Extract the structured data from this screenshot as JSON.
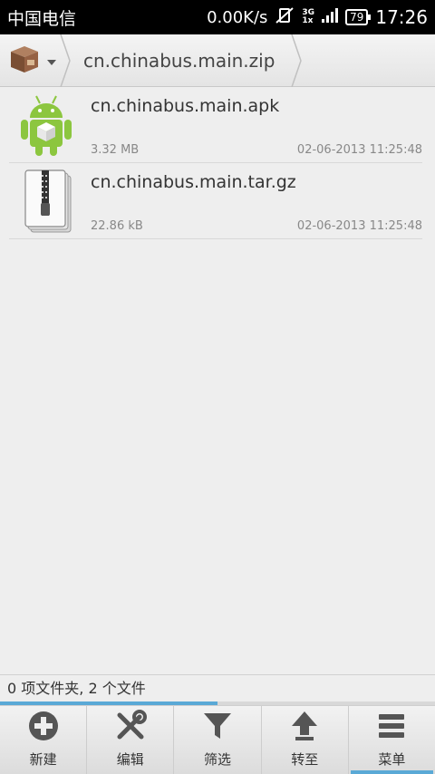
{
  "status": {
    "carrier": "中国电信",
    "netspeed": "0.00K/s",
    "sig_top": "3G",
    "sig_bottom": "1x",
    "battery": "79",
    "time": "17:26"
  },
  "breadcrumb": {
    "home_icon": "archive-box-icon",
    "path": "cn.chinabus.main.zip"
  },
  "files": [
    {
      "name": "cn.chinabus.main.apk",
      "size": "3.32 MB",
      "date": "02-06-2013 11:25:48",
      "icon": "android-apk-icon"
    },
    {
      "name": "cn.chinabus.main.tar.gz",
      "size": "22.86 kB",
      "date": "02-06-2013 11:25:48",
      "icon": "zip-archive-icon"
    }
  ],
  "summary": "0 项文件夹, 2 个文件",
  "progress": 0.5,
  "toolbar": {
    "new": "新建",
    "edit": "编辑",
    "filter": "筛选",
    "goto": "转至",
    "menu": "菜单"
  },
  "colors": {
    "accent": "#5aa9d6",
    "android_green": "#8cc63f"
  }
}
